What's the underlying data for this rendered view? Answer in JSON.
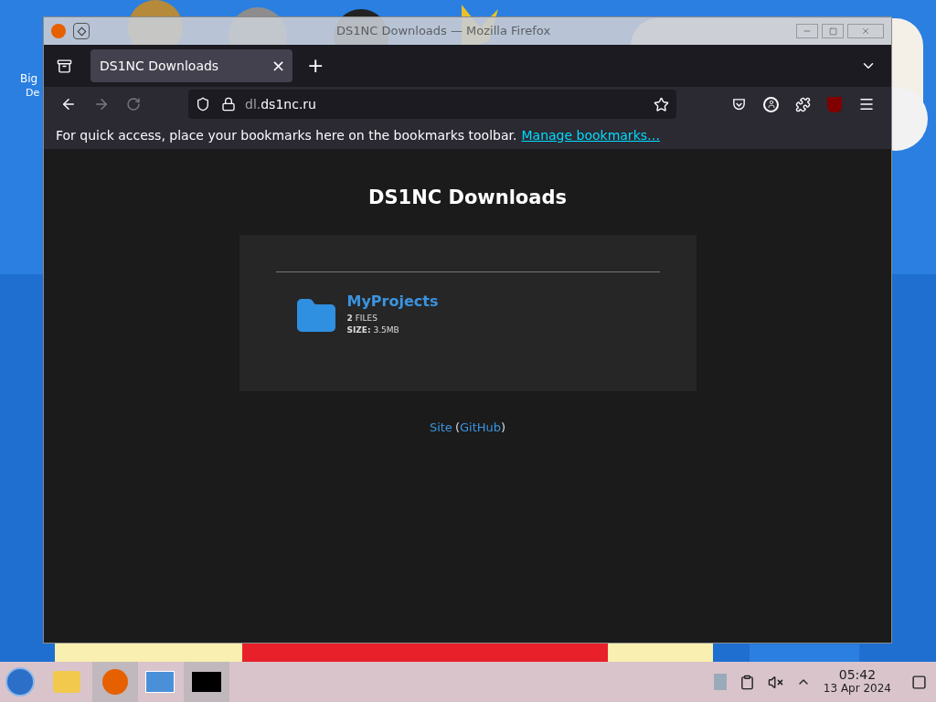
{
  "desktop": {
    "icons": [
      {
        "label": "Big"
      },
      {
        "label": "De"
      }
    ]
  },
  "window": {
    "title": "DS1NC Downloads — Mozilla Firefox"
  },
  "tabs": [
    {
      "label": "DS1NC Downloads",
      "selected": true,
      "close": "×"
    }
  ],
  "new_tab": "+",
  "address_bar": {
    "host_prefix": "dl.",
    "host": "ds1nc.ru"
  },
  "bookmarks_bar": {
    "message": "For quick access, place your bookmarks here on the bookmarks toolbar.",
    "link": "Manage bookmarks…"
  },
  "page": {
    "heading": "DS1NC Downloads",
    "folders": [
      {
        "name": "MyProjects",
        "files": "**2** FILES",
        "size": "**SIZE:** 3.5MB"
      }
    ],
    "footer": {
      "site": "Site",
      "open": "(",
      "github": "GitHub",
      "close": ")"
    }
  },
  "taskbar": {
    "time": "05:42",
    "date": "13 Apr 2024"
  }
}
